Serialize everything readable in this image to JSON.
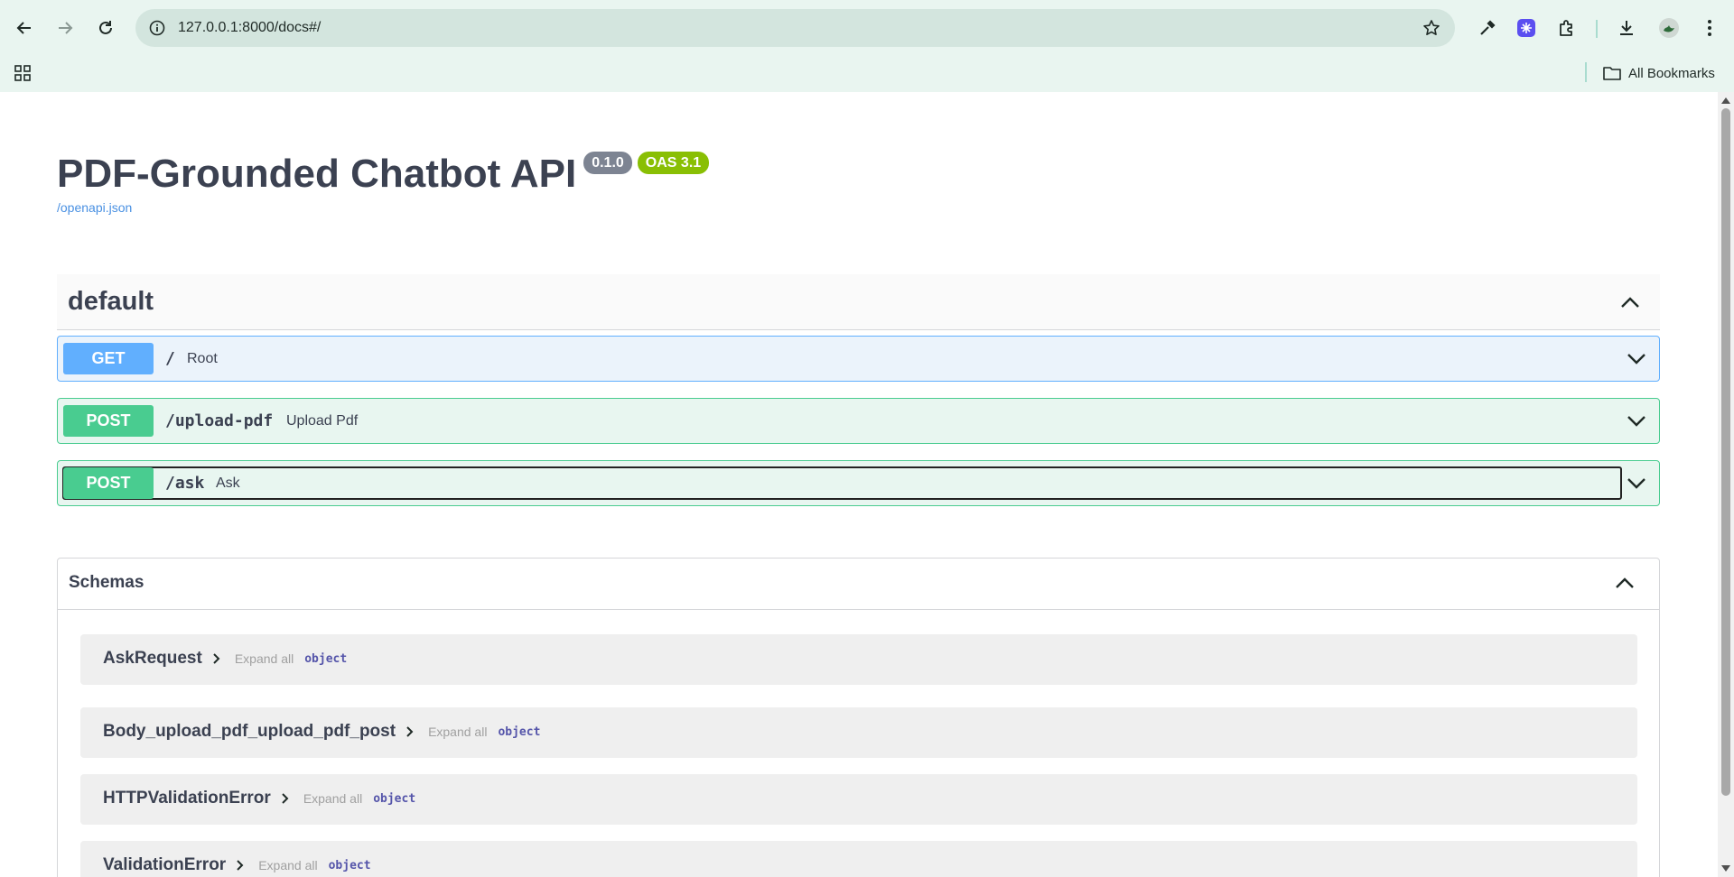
{
  "browser": {
    "url": "127.0.0.1:8000/docs#/",
    "bookmarks_label": "All Bookmarks",
    "icons": [
      "back-arrow-icon",
      "forward-arrow-icon",
      "reload-icon",
      "site-info-icon",
      "bookmark-star-icon",
      "eyedropper-icon",
      "extension-icon",
      "puzzle-icon",
      "download-icon",
      "profile-avatar-icon",
      "more-menu-icon",
      "apps-grid-icon",
      "folder-icon"
    ]
  },
  "api": {
    "title": "PDF-Grounded Chatbot API",
    "version": "0.1.0",
    "oas": "OAS 3.1",
    "spec_link": "/openapi.json"
  },
  "tag": {
    "name": "default"
  },
  "operations": [
    {
      "method": "GET",
      "path": "/",
      "summary": "Root"
    },
    {
      "method": "POST",
      "path": "/upload-pdf",
      "summary": "Upload Pdf"
    },
    {
      "method": "POST",
      "path": "/ask",
      "summary": "Ask"
    }
  ],
  "schemas": {
    "title": "Schemas",
    "models": [
      {
        "name": "AskRequest",
        "expand": "Expand all",
        "type": "object"
      },
      {
        "name": "Body_upload_pdf_upload_pdf_post",
        "expand": "Expand all",
        "type": "object"
      },
      {
        "name": "HTTPValidationError",
        "expand": "Expand all",
        "type": "object"
      },
      {
        "name": "ValidationError",
        "expand": "Expand all",
        "type": "object"
      }
    ]
  },
  "colors": {
    "get": "#61affe",
    "post": "#49cc90",
    "version_badge": "#7d8492",
    "oas_badge": "#89bf04",
    "chrome_bg": "#e9f5f0"
  }
}
